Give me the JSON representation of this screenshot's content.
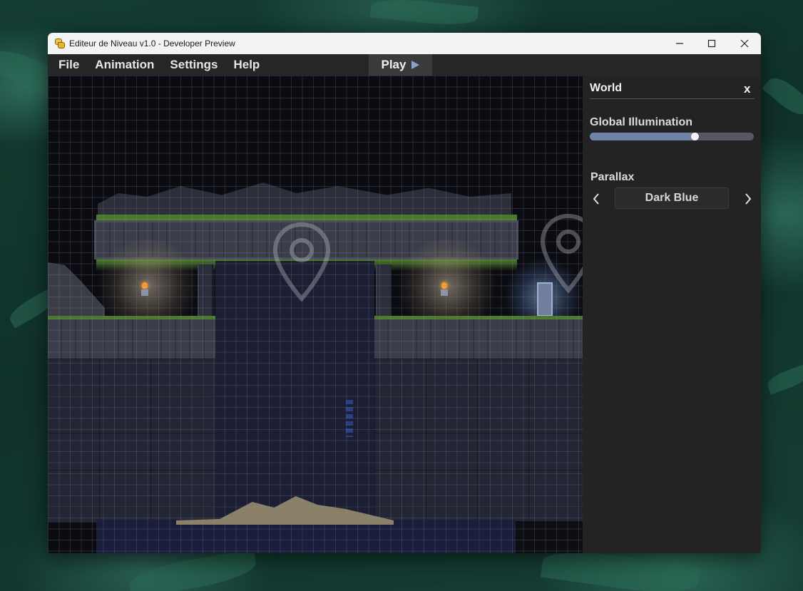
{
  "window": {
    "title": "Editeur de Niveau v1.0 - Developer Preview",
    "controls": [
      "minimize",
      "maximize",
      "close"
    ]
  },
  "menu": {
    "items": [
      "File",
      "Animation",
      "Settings",
      "Help"
    ],
    "play_label": "Play"
  },
  "panel": {
    "title": "World",
    "close_label": "x",
    "global_illumination": {
      "label": "Global Illumination",
      "value": 0.64
    },
    "parallax": {
      "label": "Parallax",
      "value": "Dark Blue"
    }
  },
  "colors": {
    "slider_fill": "#6f82a8",
    "play_icon": "#8aa0d0",
    "panel_bg": "#232323",
    "menubar_bg": "#262626"
  }
}
